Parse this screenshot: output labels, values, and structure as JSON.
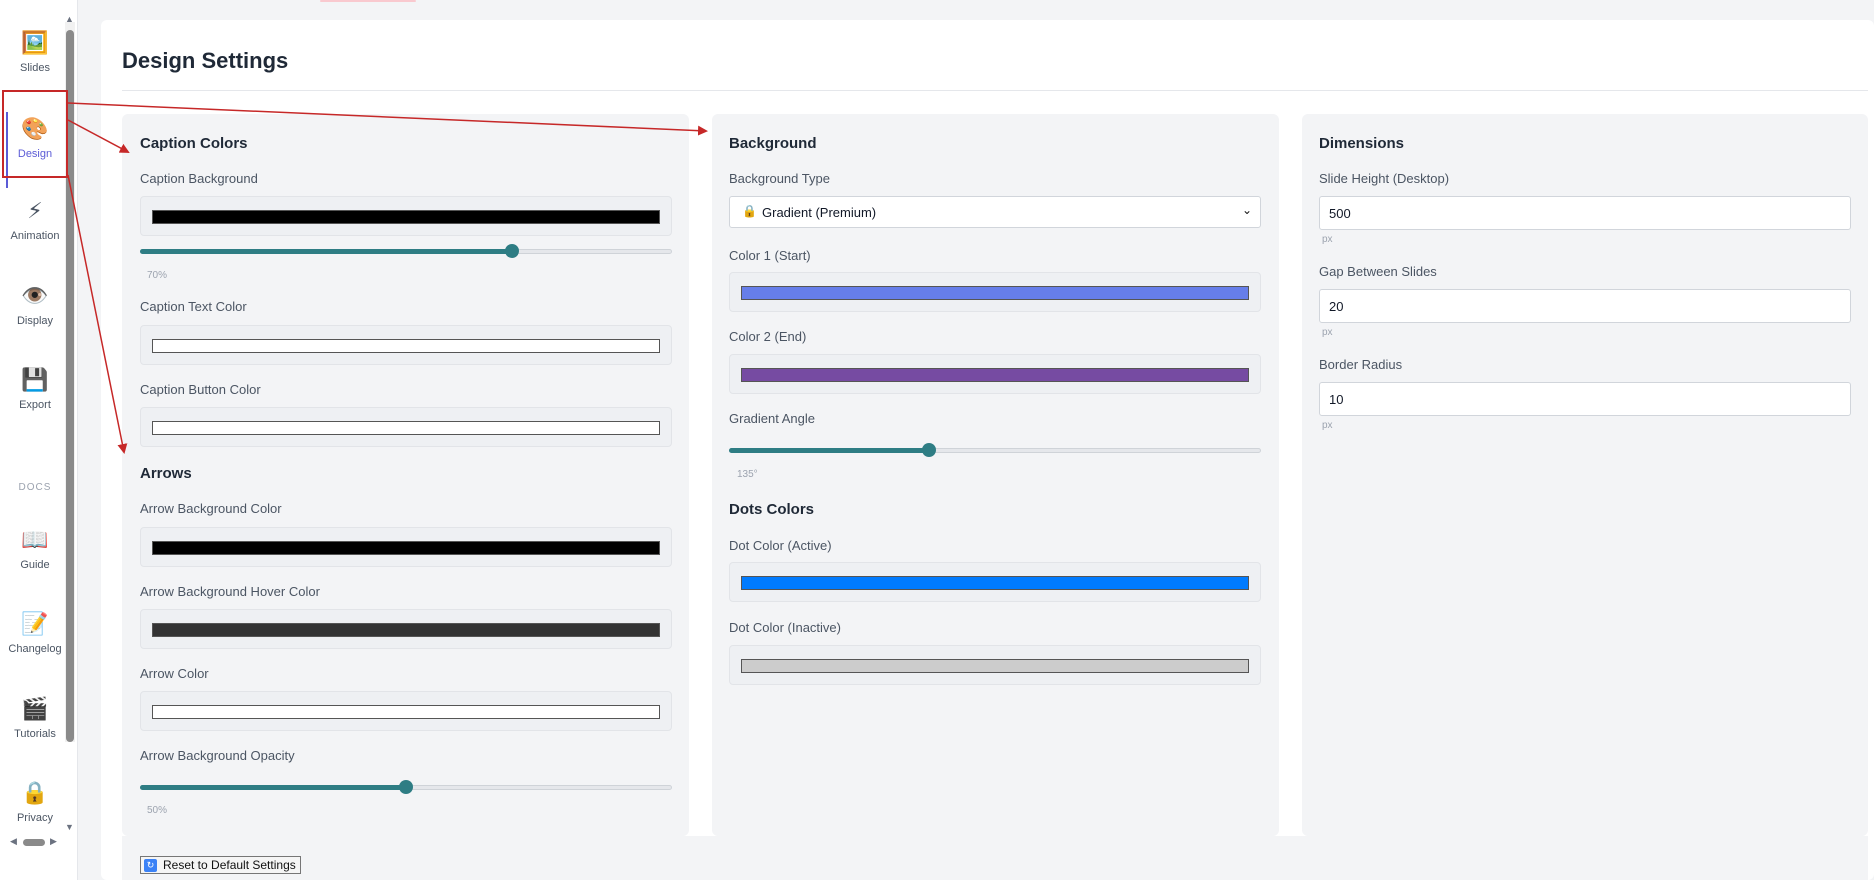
{
  "sidebar": {
    "items": [
      {
        "label": "Slides",
        "icon": "image-icon",
        "glyph": "🖼️"
      },
      {
        "label": "Design",
        "icon": "palette-icon",
        "glyph": "🎨"
      },
      {
        "label": "Animation",
        "icon": "lightning-icon",
        "glyph": "⚡"
      },
      {
        "label": "Display",
        "icon": "eye-icon",
        "glyph": "👁️"
      },
      {
        "label": "Export",
        "icon": "floppy-disk-icon",
        "glyph": "💾"
      }
    ],
    "docs_label": "DOCS",
    "docs_items": [
      {
        "label": "Guide",
        "icon": "book-icon",
        "glyph": "📖"
      },
      {
        "label": "Changelog",
        "icon": "memo-icon",
        "glyph": "📝"
      },
      {
        "label": "Tutorials",
        "icon": "clapper-icon",
        "glyph": "🎬"
      },
      {
        "label": "Privacy",
        "icon": "lock-icon",
        "glyph": "🔒"
      }
    ],
    "active": "Design"
  },
  "page": {
    "title": "Design Settings"
  },
  "caption_colors": {
    "title": "Caption Colors",
    "caption_background": {
      "label": "Caption Background",
      "color": "#000000"
    },
    "caption_opacity": {
      "value": 70,
      "value_label": "70%"
    },
    "caption_text_color": {
      "label": "Caption Text Color",
      "color": "#ffffff"
    },
    "caption_button_color": {
      "label": "Caption Button Color",
      "color": "#ffffff"
    }
  },
  "arrows": {
    "title": "Arrows",
    "arrow_background_color": {
      "label": "Arrow Background Color",
      "color": "#000000"
    },
    "arrow_background_hover_color": {
      "label": "Arrow Background Hover Color",
      "color": "#333333"
    },
    "arrow_color": {
      "label": "Arrow Color",
      "color": "#ffffff"
    },
    "arrow_background_opacity": {
      "label": "Arrow Background Opacity",
      "value": 50,
      "value_label": "50%"
    }
  },
  "background": {
    "title": "Background",
    "background_type": {
      "label": "Background Type",
      "selected": "Gradient (Premium)",
      "lock_glyph": "🔒"
    },
    "color1": {
      "label": "Color 1 (Start)",
      "color": "#667eea"
    },
    "color2": {
      "label": "Color 2 (End)",
      "color": "#764ba2"
    },
    "gradient_angle": {
      "label": "Gradient Angle",
      "value": 135,
      "max": 360,
      "value_label": "135°"
    }
  },
  "dots_colors": {
    "title": "Dots Colors",
    "dot_active": {
      "label": "Dot Color (Active)",
      "color": "#007bff"
    },
    "dot_inactive": {
      "label": "Dot Color (Inactive)",
      "color": "#cccccc"
    }
  },
  "dimensions": {
    "title": "Dimensions",
    "slide_height": {
      "label": "Slide Height (Desktop)",
      "value": "500",
      "unit": "px"
    },
    "gap": {
      "label": "Gap Between Slides",
      "value": "20",
      "unit": "px"
    },
    "border_radius": {
      "label": "Border Radius",
      "value": "10",
      "unit": "px"
    }
  },
  "footer": {
    "reset_label": "Reset to Default Settings",
    "reset_icon": "refresh-icon",
    "reset_glyph": "↻"
  },
  "colors": {
    "accent": "#2e7d84",
    "annotation": "#c62828",
    "active_nav": "#5b5bd6"
  }
}
